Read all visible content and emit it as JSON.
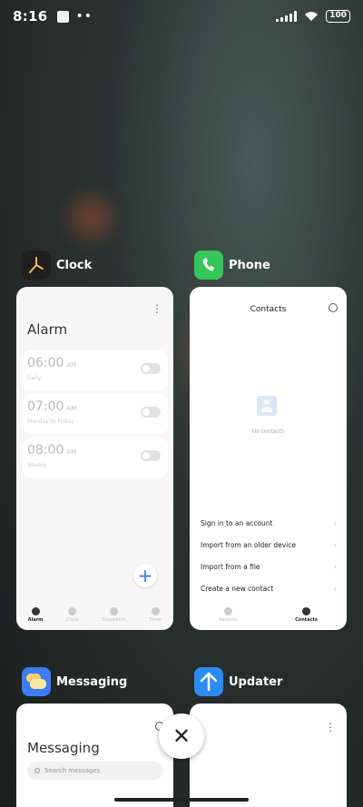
{
  "status": {
    "time": "8:16",
    "battery": "100",
    "overflow": "••"
  },
  "apps": {
    "clock": {
      "name": "Clock",
      "title": "Alarm",
      "alarms": [
        {
          "time": "06:00",
          "ampm": "AM",
          "sub": "Daily"
        },
        {
          "time": "07:00",
          "ampm": "AM",
          "sub": "Monday to Friday"
        },
        {
          "time": "08:00",
          "ampm": "AM",
          "sub": "Weekly"
        }
      ],
      "add": "+",
      "tabs": [
        "Alarm",
        "Clock",
        "Stopwatch",
        "Timer"
      ]
    },
    "phone": {
      "name": "Phone",
      "title": "Contacts",
      "empty": "No contacts",
      "options": [
        "Sign in to an account",
        "Import from an older device",
        "Import from a file",
        "Create a new contact"
      ],
      "tabs": [
        "Recents",
        "Contacts"
      ]
    },
    "messaging": {
      "name": "Messaging",
      "title": "Messaging",
      "search_placeholder": "Search messages"
    },
    "updater": {
      "name": "Updater"
    }
  },
  "close_label": "✕",
  "chevron": "›",
  "kebab": "⋮",
  "colors": {
    "accent": "#2a7ef0",
    "phone": "#35c759",
    "updater": "#2a8cf5",
    "messaging": "#3d7df5"
  }
}
